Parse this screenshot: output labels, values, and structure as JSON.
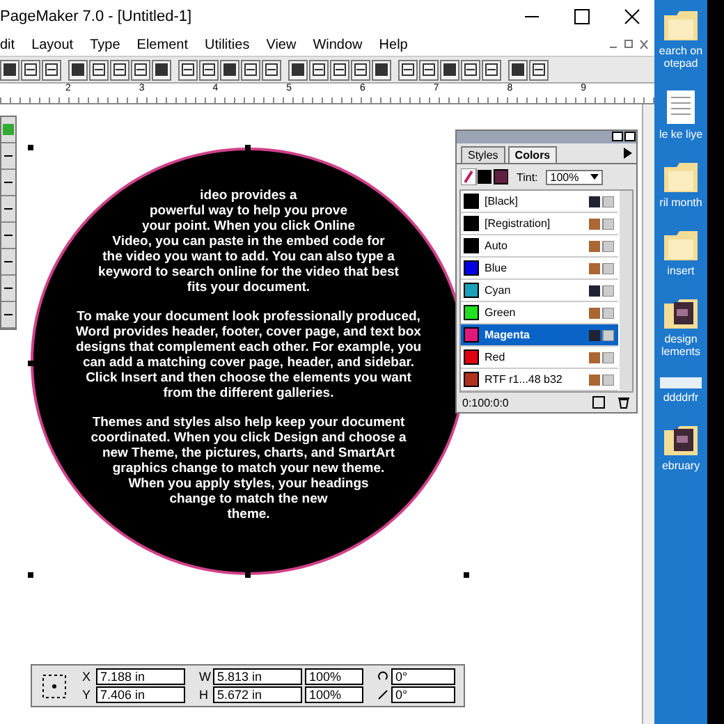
{
  "window": {
    "title": "PageMaker 7.0 - [Untitled-1]"
  },
  "menu": [
    "dit",
    "Layout",
    "Type",
    "Element",
    "Utilities",
    "View",
    "Window",
    "Help"
  ],
  "ruler_labels": [
    "2",
    "3",
    "4",
    "5",
    "6",
    "7",
    "8",
    "9"
  ],
  "story": [
    [
      "ideo provides a",
      "powerful way to help you prove",
      "your point. When you click Online",
      "Video, you can paste in the embed code for",
      "the video you want to add. You can also type a",
      "keyword to search online for the video that best",
      "fits your document."
    ],
    [
      "To make your document look professionally produced,",
      "Word provides header, footer, cover page, and text box",
      "designs that complement each other. For example, you",
      "can add a matching cover page, header, and sidebar.",
      "Click Insert and then choose the elements you want",
      "from the different galleries."
    ],
    [
      "Themes and styles also help keep your document",
      "coordinated. When you click Design and choose a",
      "new Theme, the pictures, charts, and SmartArt",
      "graphics change to match your new theme.",
      "When you apply styles, your headings",
      "change to match the new",
      "theme."
    ]
  ],
  "colors_palette": {
    "tabs": [
      {
        "label": "Styles",
        "selected": false
      },
      {
        "label": "Colors",
        "selected": true
      }
    ],
    "tint_label": "Tint:",
    "tint": "100%",
    "swatches": [
      {
        "name": "[Black]",
        "color": "#000000",
        "selected": false,
        "process": true
      },
      {
        "name": "[Registration]",
        "color": "#000000",
        "selected": false,
        "process": false
      },
      {
        "name": "Auto",
        "color": "#000000",
        "selected": false,
        "process": false
      },
      {
        "name": "Blue",
        "color": "#0000e0",
        "selected": false,
        "process": false
      },
      {
        "name": "Cyan",
        "color": "#1aa0b8",
        "selected": false,
        "process": true
      },
      {
        "name": "Green",
        "color": "#20e020",
        "selected": false,
        "process": false
      },
      {
        "name": "Magenta",
        "color": "#e0187a",
        "selected": true,
        "process": true
      },
      {
        "name": "Red",
        "color": "#e00010",
        "selected": false,
        "process": false
      },
      {
        "name": "RTF r1...48 b32",
        "color": "#b03020",
        "selected": false,
        "process": false
      }
    ],
    "footer": "0:100:0:0"
  },
  "control_palette": {
    "x": "7.188 in",
    "y": "7.406 in",
    "w": "5.813 in",
    "h": "5.672 in",
    "w_scale": "100%",
    "h_scale": "100%",
    "rotation": "0°",
    "skew": "0°",
    "x_label": "X",
    "y_label": "Y",
    "w_label": "W",
    "h_label": "H"
  },
  "desktop_icons": [
    {
      "kind": "folder",
      "label": "earch on otepad"
    },
    {
      "kind": "document",
      "label": "le ke liye"
    },
    {
      "kind": "folder",
      "label": "ril month"
    },
    {
      "kind": "folder",
      "label": "insert"
    },
    {
      "kind": "photo-folder",
      "label": "design lements"
    },
    {
      "kind": "bar",
      "label": "ddddrfr"
    },
    {
      "kind": "photo-folder",
      "label": "ebruary"
    }
  ]
}
